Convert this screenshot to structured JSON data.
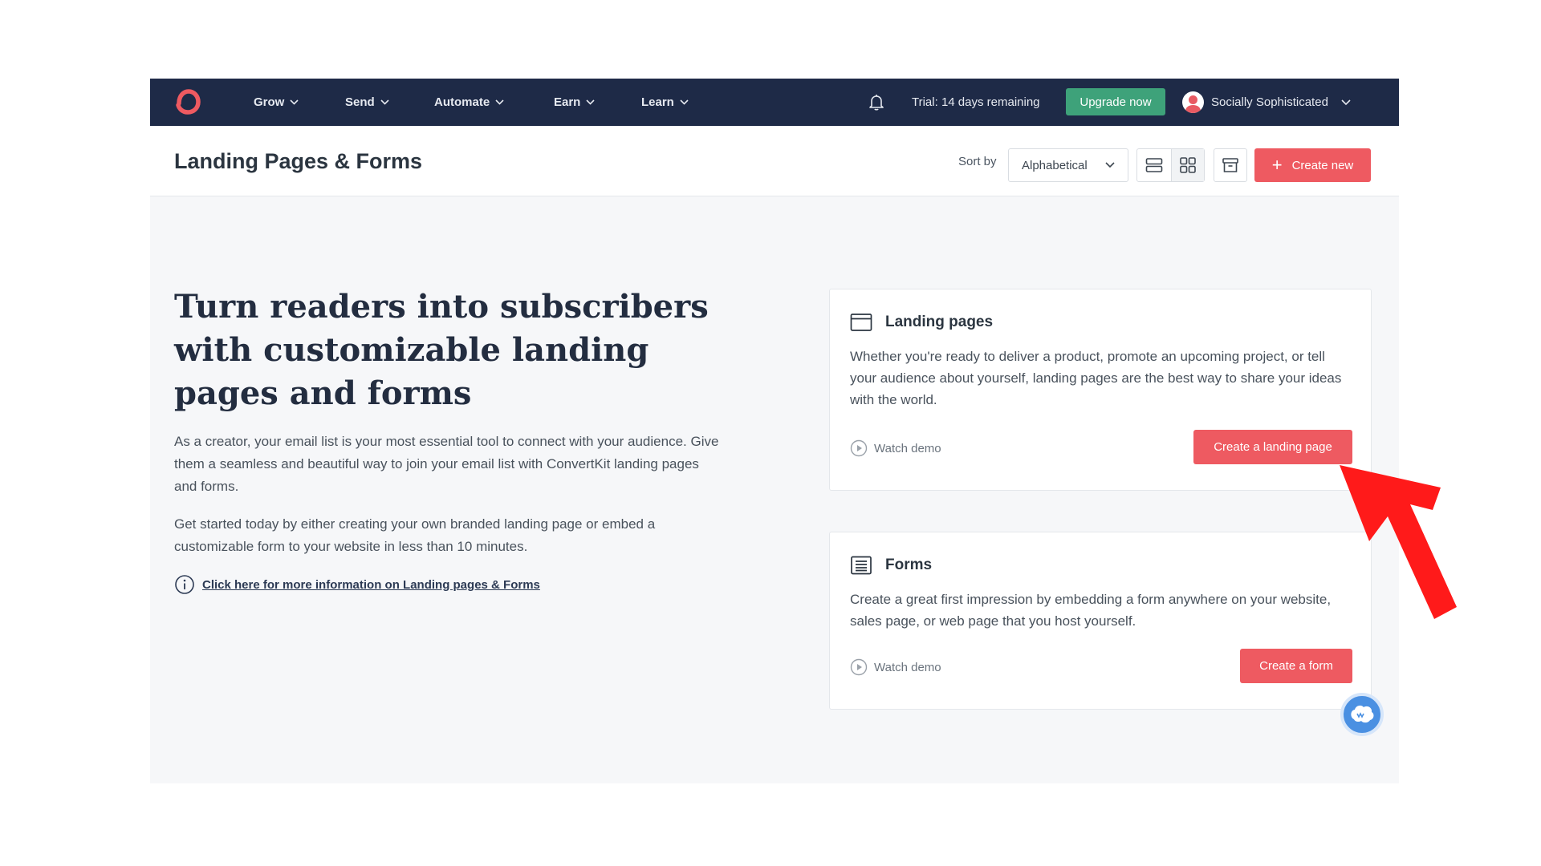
{
  "nav": {
    "items": [
      {
        "label": "Grow"
      },
      {
        "label": "Send"
      },
      {
        "label": "Automate"
      },
      {
        "label": "Earn"
      },
      {
        "label": "Learn"
      }
    ],
    "trial_text": "Trial: 14 days remaining",
    "upgrade_label": "Upgrade now",
    "account_name": "Socially Sophisticated"
  },
  "header": {
    "title": "Landing Pages & Forms",
    "sort_label": "Sort by",
    "sort_value": "Alphabetical",
    "create_new_label": "Create new"
  },
  "hero": {
    "title": "Turn readers into subscribers with customizable landing pages and forms",
    "paragraph1": "As a creator, your email list is your most essential tool to connect with your audience. Give them a seamless and beautiful way to join your email list with ConvertKit landing pages and forms.",
    "paragraph2": "Get started today by either creating your own branded landing page or embed a customizable form to your website in less than 10 minutes.",
    "info_link": "Click here for more information on Landing pages & Forms"
  },
  "cards": {
    "landing": {
      "title": "Landing pages",
      "text": "Whether you're ready to deliver a product, promote an upcoming project, or tell your audience about yourself, landing pages are the best way to share your ideas with the world.",
      "watch_label": "Watch demo",
      "button_label": "Create a landing page"
    },
    "forms": {
      "title": "Forms",
      "text": "Create a great first impression by embedding a form anywhere on your website, sales page, or web page that you host yourself.",
      "watch_label": "Watch demo",
      "button_label": "Create a form"
    }
  },
  "colors": {
    "nav_bg": "#1e2a47",
    "brand_red": "#ee5a61",
    "upgrade_green": "#3ea27a",
    "page_bg": "#f6f7f9",
    "annotation_red": "#ff1a1a"
  },
  "icons": [
    "convertkit-logo-icon",
    "chevron-down-icon",
    "bell-icon",
    "list-view-icon",
    "grid-view-icon",
    "archive-icon",
    "plus-icon",
    "info-icon",
    "browser-window-icon",
    "form-icon",
    "play-circle-icon",
    "chat-widget-icon",
    "annotation-arrow"
  ]
}
